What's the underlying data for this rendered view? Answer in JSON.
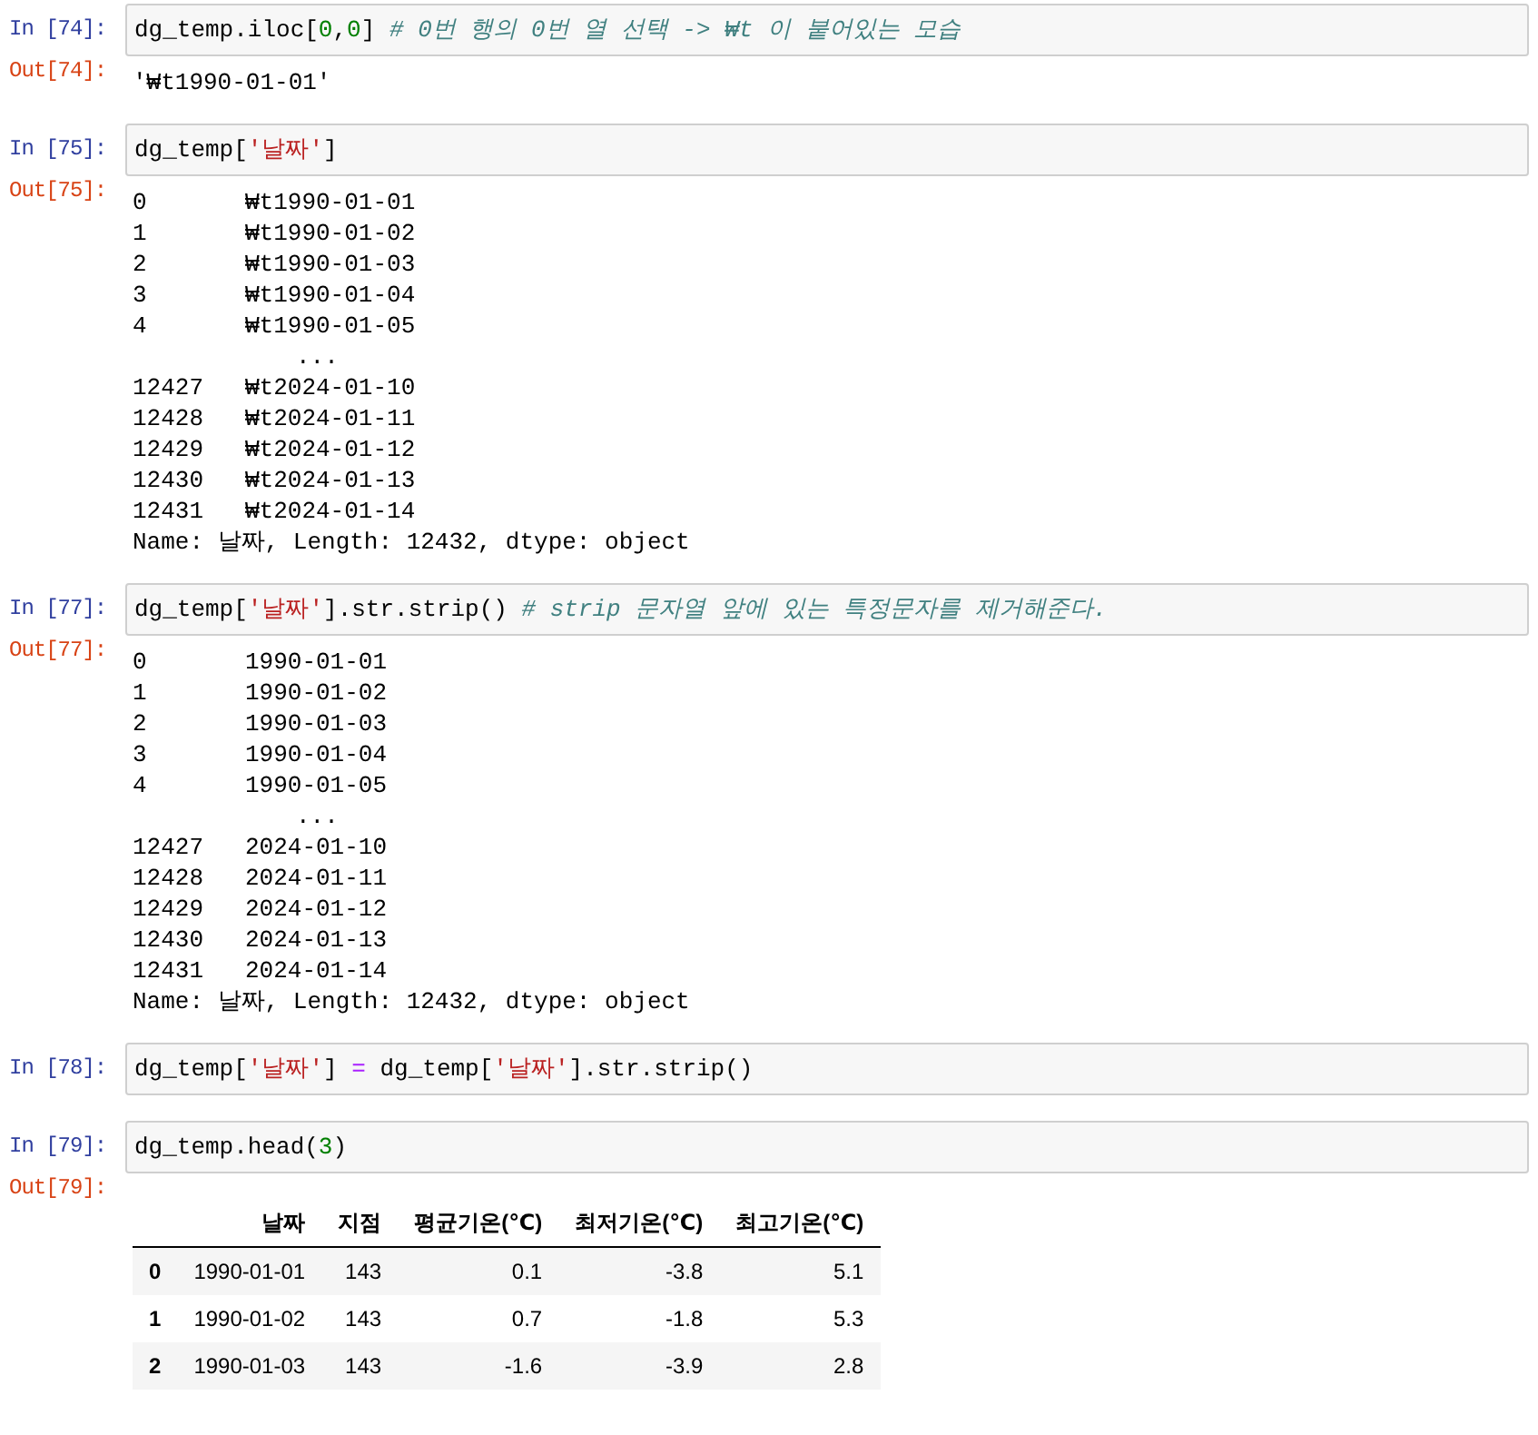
{
  "cells": [
    {
      "prompt_in": "In [74]:",
      "code": [
        {
          "kind": "plain",
          "text": "dg_temp.iloc["
        },
        {
          "kind": "number",
          "text": "0"
        },
        {
          "kind": "plain",
          "text": ","
        },
        {
          "kind": "number",
          "text": "0"
        },
        {
          "kind": "plain",
          "text": "] "
        },
        {
          "kind": "comment",
          "text": "# 0번 행의 0번 열 선택 -> ₩t 이 붙어있는 모습"
        }
      ],
      "prompt_out": "Out[74]:",
      "output": {
        "kind": "text",
        "text": "'₩t1990-01-01'"
      }
    },
    {
      "prompt_in": "In [75]:",
      "code": [
        {
          "kind": "plain",
          "text": "dg_temp["
        },
        {
          "kind": "string",
          "text": "'날짜'"
        },
        {
          "kind": "plain",
          "text": "]"
        }
      ],
      "prompt_out": "Out[75]:",
      "output": {
        "kind": "series",
        "rows": [
          {
            "index": "0",
            "value": "₩t1990-01-01"
          },
          {
            "index": "1",
            "value": "₩t1990-01-02"
          },
          {
            "index": "2",
            "value": "₩t1990-01-03"
          },
          {
            "index": "3",
            "value": "₩t1990-01-04"
          },
          {
            "index": "4",
            "value": "₩t1990-01-05"
          },
          {
            "index": "",
            "value": "..."
          },
          {
            "index": "12427",
            "value": "₩t2024-01-10"
          },
          {
            "index": "12428",
            "value": "₩t2024-01-11"
          },
          {
            "index": "12429",
            "value": "₩t2024-01-12"
          },
          {
            "index": "12430",
            "value": "₩t2024-01-13"
          },
          {
            "index": "12431",
            "value": "₩t2024-01-14"
          }
        ],
        "footer": "Name: 날짜, Length: 12432, dtype: object"
      }
    },
    {
      "prompt_in": "In [77]:",
      "code": [
        {
          "kind": "plain",
          "text": "dg_temp["
        },
        {
          "kind": "string",
          "text": "'날짜'"
        },
        {
          "kind": "plain",
          "text": "].str.strip() "
        },
        {
          "kind": "comment",
          "text": "# strip 문자열 앞에 있는 특정문자를 제거해준다."
        }
      ],
      "prompt_out": "Out[77]:",
      "output": {
        "kind": "series",
        "rows": [
          {
            "index": "0",
            "value": "1990-01-01"
          },
          {
            "index": "1",
            "value": "1990-01-02"
          },
          {
            "index": "2",
            "value": "1990-01-03"
          },
          {
            "index": "3",
            "value": "1990-01-04"
          },
          {
            "index": "4",
            "value": "1990-01-05"
          },
          {
            "index": "",
            "value": "..."
          },
          {
            "index": "12427",
            "value": "2024-01-10"
          },
          {
            "index": "12428",
            "value": "2024-01-11"
          },
          {
            "index": "12429",
            "value": "2024-01-12"
          },
          {
            "index": "12430",
            "value": "2024-01-13"
          },
          {
            "index": "12431",
            "value": "2024-01-14"
          }
        ],
        "footer": "Name: 날짜, Length: 12432, dtype: object"
      }
    },
    {
      "prompt_in": "In [78]:",
      "code": [
        {
          "kind": "plain",
          "text": "dg_temp["
        },
        {
          "kind": "string",
          "text": "'날짜'"
        },
        {
          "kind": "plain",
          "text": "] "
        },
        {
          "kind": "operator",
          "text": "="
        },
        {
          "kind": "plain",
          "text": " dg_temp["
        },
        {
          "kind": "string",
          "text": "'날짜'"
        },
        {
          "kind": "plain",
          "text": "].str.strip()"
        }
      ]
    },
    {
      "prompt_in": "In [79]:",
      "code": [
        {
          "kind": "plain",
          "text": "dg_temp.head("
        },
        {
          "kind": "number",
          "text": "3"
        },
        {
          "kind": "plain",
          "text": ")"
        }
      ],
      "prompt_out": "Out[79]:",
      "output": {
        "kind": "table",
        "columns": [
          "날짜",
          "지점",
          "평균기온(℃)",
          "최저기온(℃)",
          "최고기온(℃)"
        ],
        "rows": [
          {
            "index": "0",
            "cells": [
              "1990-01-01",
              "143",
              "0.1",
              "-3.8",
              "5.1"
            ]
          },
          {
            "index": "1",
            "cells": [
              "1990-01-02",
              "143",
              "0.7",
              "-1.8",
              "5.3"
            ]
          },
          {
            "index": "2",
            "cells": [
              "1990-01-03",
              "143",
              "-1.6",
              "-3.9",
              "2.8"
            ]
          }
        ]
      }
    }
  ]
}
